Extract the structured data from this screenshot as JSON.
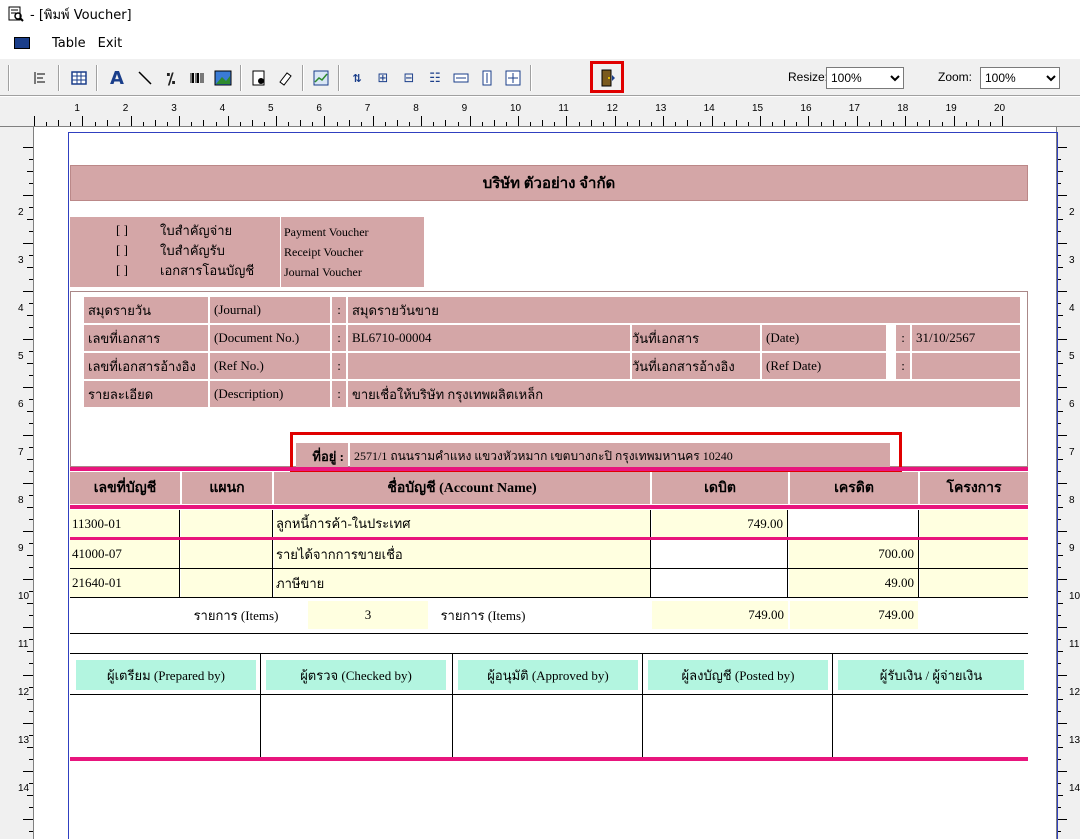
{
  "window": {
    "title": " - [พิมพ์ Voucher]",
    "icon": "print-preview-icon"
  },
  "menu": {
    "table": "Table",
    "exit": "Exit"
  },
  "toolbar": {
    "resize_label": "Resize:",
    "resize_value": "100%",
    "zoom_label": "Zoom:",
    "zoom_value": "100%",
    "icons": [
      "align-left-icon",
      "table-icon",
      "text-icon",
      "line-icon",
      "percent-icon",
      "barcode-icon",
      "image-icon",
      "page-setup-icon",
      "eraser-icon",
      "chart-icon",
      "sort-icon",
      "group-icon",
      "ungroup-icon",
      "column-icon",
      "fit-width-icon",
      "fit-height-icon",
      "fit-page-icon",
      "exit-door-icon"
    ]
  },
  "ruler": {
    "h_marks": [
      "1",
      "2",
      "3",
      "4",
      "5",
      "6",
      "7",
      "8",
      "9",
      "10",
      "11",
      "12",
      "13",
      "14",
      "15",
      "16",
      "17",
      "18",
      "19",
      "20"
    ],
    "v_marks": [
      "2",
      "3",
      "4",
      "5",
      "6",
      "7",
      "8",
      "9",
      "10",
      "11",
      "12",
      "13",
      "14"
    ]
  },
  "voucher": {
    "company": "บริษัท ตัวอย่าง จำกัด",
    "types": [
      {
        "check": "[ ]",
        "th": "ใบสำคัญจ่าย",
        "en": "Payment Voucher"
      },
      {
        "check": "[ ]",
        "th": "ใบสำคัญรับ",
        "en": "Receipt Voucher"
      },
      {
        "check": "[ ]",
        "th": "เอกสารโอนบัญชี",
        "en": "Journal Voucher"
      }
    ],
    "journal_label": "สมุดรายวัน",
    "journal_en": "(Journal)",
    "journal_value": "สมุดรายวันขาย",
    "docno_label": "เลขที่เอกสาร",
    "docno_en": "(Document No.)",
    "docno_value": "BL6710-00004",
    "date_label": "วันที่เอกสาร",
    "date_en": "(Date)",
    "date_value": "31/10/2567",
    "refno_label": "เลขที่เอกสารอ้างอิง",
    "refno_en": "(Ref No.)",
    "refno_value": "",
    "refdate_label": "วันที่เอกสารอ้างอิง",
    "refdate_en": "(Ref Date)",
    "refdate_value": "",
    "desc_label": "รายละเอียด",
    "desc_en": "(Description)",
    "desc_value": "ขายเชื่อให้บริษัท กรุงเทพผลิตเหล็ก",
    "address_label": "ที่อยู่ :",
    "address_value": "2571/1 ถนนรามคำแหง แขวงหัวหมาก เขตบางกะปิ กรุงเทพมหานคร 10240",
    "colon": ":",
    "headers": {
      "account_no": "เลขที่บัญชี",
      "dept": "แผนก",
      "account_name": "ชื่อบัญชี (Account Name)",
      "debit": "เดบิต",
      "credit": "เครดิต",
      "project": "โครงการ"
    },
    "rows": [
      {
        "account_no": "11300-01",
        "dept": "",
        "name": "ลูกหนี้การค้า-ในประเทศ",
        "debit": "749.00",
        "credit": "",
        "project": ""
      },
      {
        "account_no": "41000-07",
        "dept": "",
        "name": "รายได้จากการขายเชื่อ",
        "debit": "",
        "credit": "700.00",
        "project": ""
      },
      {
        "account_no": "21640-01",
        "dept": "",
        "name": "ภาษีขาย",
        "debit": "",
        "credit": "49.00",
        "project": ""
      }
    ],
    "total": {
      "items_label": "รายการ (Items)",
      "items_count": "3",
      "items_label2": "รายการ (Items)",
      "debit": "749.00",
      "credit": "749.00"
    },
    "signatures": [
      "ผู้เตรียม (Prepared by)",
      "ผู้ตรวจ (Checked by)",
      "ผู้อนุมัติ (Approved by)",
      "ผู้ลงบัญชี (Posted by)",
      "ผู้รับเงิน / ผู้จ่ายเงิน"
    ]
  },
  "colors": {
    "pink": "#d4a6a7",
    "yellow": "#ffffe0",
    "mint": "#b3f5e0",
    "magenta": "#e8157d",
    "highlight": "#e00000"
  }
}
